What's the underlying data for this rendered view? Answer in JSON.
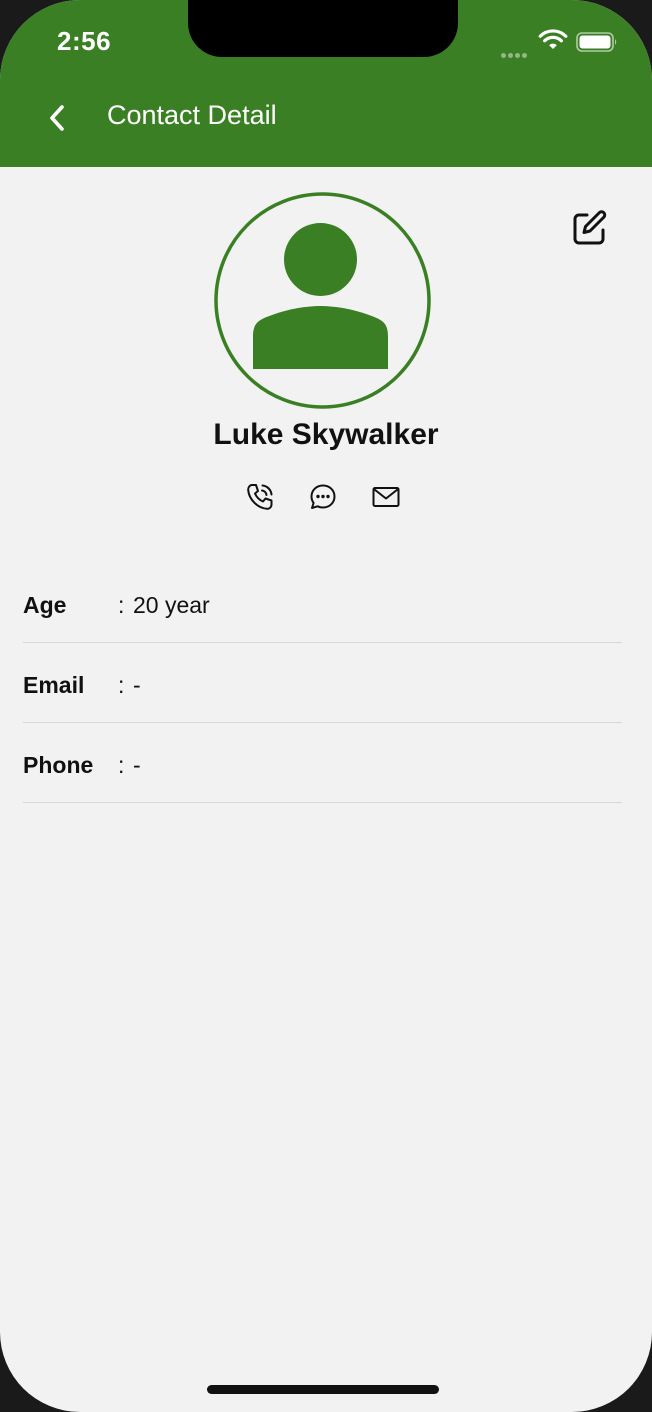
{
  "status_bar": {
    "time": "2:56"
  },
  "nav": {
    "title": "Contact Detail",
    "back_icon": "chevron-left-icon"
  },
  "theme": {
    "primary": "#3a7f23",
    "background": "#f2f2f2"
  },
  "contact": {
    "name": "Luke Skywalker",
    "avatar_icon": "person-icon"
  },
  "actions": {
    "call_icon": "phone-icon",
    "message_icon": "chat-bubble-icon",
    "email_icon": "envelope-icon",
    "edit_icon": "edit-icon"
  },
  "details": [
    {
      "label": "Age",
      "separator": ":",
      "value": "20 year"
    },
    {
      "label": "Email",
      "separator": ":",
      "value": "-"
    },
    {
      "label": "Phone",
      "separator": ":",
      "value": "-"
    }
  ]
}
